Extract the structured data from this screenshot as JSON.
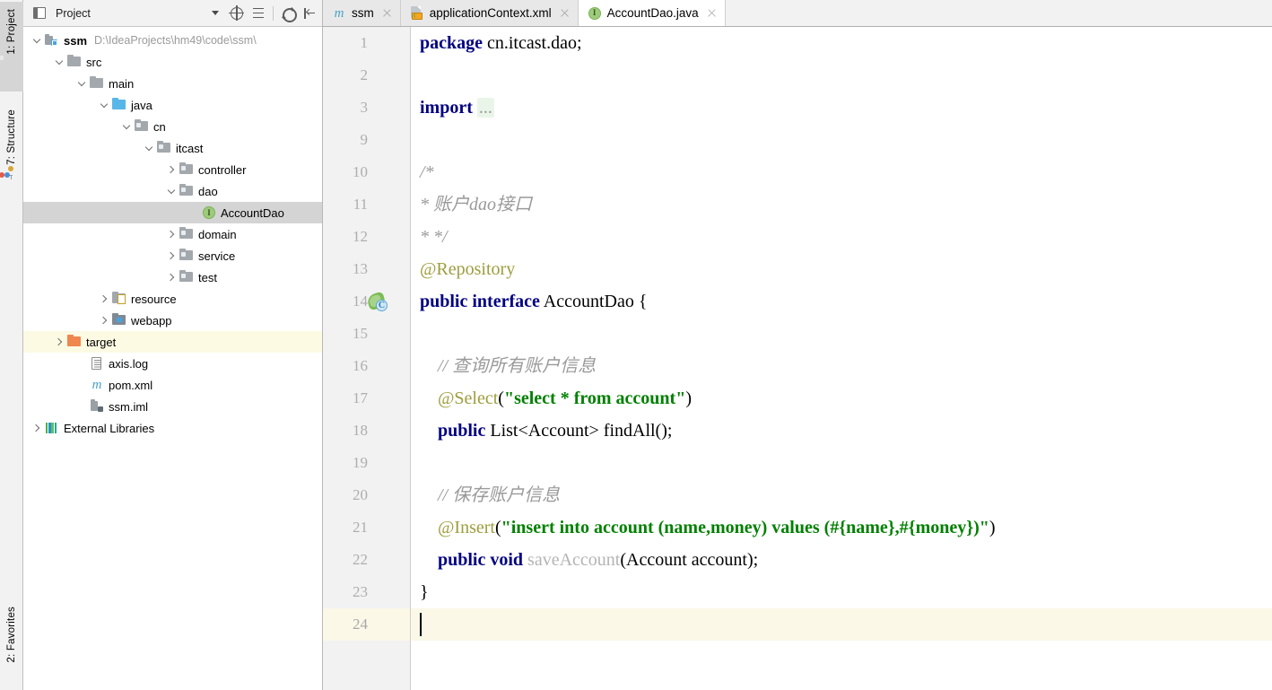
{
  "toolwindows": {
    "left": [
      {
        "label": "1: Project",
        "icon": "project-icon",
        "active": true
      },
      {
        "label": "7: Structure",
        "icon": "structure-icon",
        "active": false
      },
      {
        "label": "2: Favorites",
        "icon": "favorites-icon",
        "active": false
      }
    ]
  },
  "project_panel": {
    "title": "Project",
    "toolbar": [
      {
        "name": "view-mode-dropdown",
        "icon": "chevron-down-icon"
      },
      {
        "name": "select-opened-file",
        "icon": "locate-crosshair-icon"
      },
      {
        "name": "collapse-all",
        "icon": "collapse-all-icon"
      },
      {
        "name": "settings",
        "icon": "gear-icon"
      },
      {
        "name": "hide-panel",
        "icon": "hide-panel-icon"
      }
    ],
    "tree": [
      {
        "label": "ssm",
        "path": "D:\\IdeaProjects\\hm49\\code\\ssm\\",
        "icon": "module-icon",
        "depth": 0,
        "state": "expanded",
        "bold": true,
        "selected": false,
        "highlight": false
      },
      {
        "label": "src",
        "icon": "folder-gray-icon",
        "depth": 1,
        "state": "expanded",
        "bold": false,
        "selected": false,
        "highlight": false
      },
      {
        "label": "main",
        "icon": "folder-gray-icon",
        "depth": 2,
        "state": "expanded",
        "bold": false,
        "selected": false,
        "highlight": false
      },
      {
        "label": "java",
        "icon": "folder-source-blue-icon",
        "depth": 3,
        "state": "expanded",
        "bold": false,
        "selected": false,
        "highlight": false
      },
      {
        "label": "cn",
        "icon": "package-icon",
        "depth": 4,
        "state": "expanded",
        "bold": false,
        "selected": false,
        "highlight": false
      },
      {
        "label": "itcast",
        "icon": "package-icon",
        "depth": 5,
        "state": "expanded",
        "bold": false,
        "selected": false,
        "highlight": false
      },
      {
        "label": "controller",
        "icon": "package-icon",
        "depth": 6,
        "state": "collapsed",
        "bold": false,
        "selected": false,
        "highlight": false
      },
      {
        "label": "dao",
        "icon": "package-icon",
        "depth": 6,
        "state": "expanded",
        "bold": false,
        "selected": false,
        "highlight": false
      },
      {
        "label": "AccountDao",
        "icon": "interface-icon",
        "depth": 7,
        "state": "leaf",
        "bold": false,
        "selected": true,
        "highlight": false
      },
      {
        "label": "domain",
        "icon": "package-icon",
        "depth": 6,
        "state": "collapsed",
        "bold": false,
        "selected": false,
        "highlight": false
      },
      {
        "label": "service",
        "icon": "package-icon",
        "depth": 6,
        "state": "collapsed",
        "bold": false,
        "selected": false,
        "highlight": false
      },
      {
        "label": "test",
        "icon": "package-icon",
        "depth": 6,
        "state": "collapsed",
        "bold": false,
        "selected": false,
        "highlight": false
      },
      {
        "label": "resource",
        "icon": "folder-resources-icon",
        "depth": 3,
        "state": "collapsed",
        "bold": false,
        "selected": false,
        "highlight": false
      },
      {
        "label": "webapp",
        "icon": "folder-webapp-icon",
        "depth": 3,
        "state": "collapsed",
        "bold": false,
        "selected": false,
        "highlight": false
      },
      {
        "label": "target",
        "icon": "folder-orange-icon",
        "depth": 1,
        "state": "collapsed",
        "bold": false,
        "selected": false,
        "highlight": true
      },
      {
        "label": "axis.log",
        "icon": "log-file-icon",
        "depth": 2,
        "state": "leaf",
        "bold": false,
        "selected": false,
        "highlight": false
      },
      {
        "label": "pom.xml",
        "icon": "maven-icon",
        "depth": 2,
        "state": "leaf",
        "bold": false,
        "selected": false,
        "highlight": false
      },
      {
        "label": "ssm.iml",
        "icon": "iml-file-icon",
        "depth": 2,
        "state": "leaf",
        "bold": false,
        "selected": false,
        "highlight": false
      },
      {
        "label": "External Libraries",
        "icon": "libraries-icon",
        "depth": 0,
        "state": "collapsed",
        "bold": false,
        "selected": false,
        "highlight": false
      }
    ]
  },
  "editor": {
    "tabs": [
      {
        "label": "ssm",
        "icon": "maven-icon",
        "active": false,
        "closable": true
      },
      {
        "label": "applicationContext.xml",
        "icon": "xml-file-icon",
        "active": false,
        "closable": true
      },
      {
        "label": "AccountDao.java",
        "icon": "interface-icon",
        "active": true,
        "closable": true
      }
    ],
    "file": "AccountDao.java",
    "language": "java",
    "current_line": 24,
    "gutter_icons": [
      {
        "line": 14,
        "icon": "spring-bean-icon"
      }
    ],
    "fold_markers": [
      {
        "line": 3,
        "icon": "fold-expand-icon"
      }
    ],
    "lines": [
      {
        "num": "1",
        "tokens": [
          {
            "t": "kw",
            "v": "package"
          },
          {
            "t": "plain",
            "v": " cn.itcast.dao;"
          }
        ]
      },
      {
        "num": "2",
        "tokens": []
      },
      {
        "num": "3",
        "tokens": [
          {
            "t": "kw",
            "v": "import"
          },
          {
            "t": "plain",
            "v": " "
          },
          {
            "t": "fold",
            "v": "..."
          }
        ]
      },
      {
        "num": "9",
        "tokens": []
      },
      {
        "num": "10",
        "tokens": [
          {
            "t": "cmt",
            "v": "/*"
          }
        ]
      },
      {
        "num": "11",
        "tokens": [
          {
            "t": "cmt",
            "v": "* 账户dao接口"
          }
        ]
      },
      {
        "num": "12",
        "tokens": [
          {
            "t": "cmt",
            "v": "* */"
          }
        ]
      },
      {
        "num": "13",
        "tokens": [
          {
            "t": "anno",
            "v": "@Repository"
          }
        ]
      },
      {
        "num": "14",
        "tokens": [
          {
            "t": "kw",
            "v": "public interface"
          },
          {
            "t": "plain",
            "v": " AccountDao {"
          }
        ]
      },
      {
        "num": "15",
        "tokens": []
      },
      {
        "num": "16",
        "tokens": [
          {
            "t": "cmt",
            "v": "    // 查询所有账户信息"
          }
        ]
      },
      {
        "num": "17",
        "tokens": [
          {
            "t": "anno",
            "v": "    @Select"
          },
          {
            "t": "plain",
            "v": "("
          },
          {
            "t": "str",
            "v": "\"select * from account\""
          },
          {
            "t": "plain",
            "v": ")"
          }
        ]
      },
      {
        "num": "18",
        "tokens": [
          {
            "t": "kw",
            "v": "    public"
          },
          {
            "t": "plain",
            "v": " List<Account> findAll();"
          }
        ]
      },
      {
        "num": "19",
        "tokens": []
      },
      {
        "num": "20",
        "tokens": [
          {
            "t": "cmt",
            "v": "    // 保存账户信息"
          }
        ]
      },
      {
        "num": "21",
        "tokens": [
          {
            "t": "anno",
            "v": "    @Insert"
          },
          {
            "t": "plain",
            "v": "("
          },
          {
            "t": "str",
            "v": "\"insert into account (name,money) values (#{name},#{money})\""
          },
          {
            "t": "plain",
            "v": ")"
          }
        ]
      },
      {
        "num": "22",
        "tokens": [
          {
            "t": "kw",
            "v": "    public void"
          },
          {
            "t": "plain",
            "v": " "
          },
          {
            "t": "dim",
            "v": "saveAccount"
          },
          {
            "t": "plain",
            "v": "(Account account);"
          }
        ]
      },
      {
        "num": "23",
        "tokens": [
          {
            "t": "plain",
            "v": "}"
          }
        ]
      },
      {
        "num": "24",
        "tokens": [],
        "current": true
      }
    ]
  },
  "colors": {
    "keyword": "#000080",
    "string": "#008000",
    "comment": "#9a9a9a",
    "annotation": "#9e9d3e",
    "selection": "#d4d4d4",
    "current_line": "#fbf8e8",
    "highlight_row": "#fcfae3",
    "panel_bg": "#f2f2f2"
  }
}
